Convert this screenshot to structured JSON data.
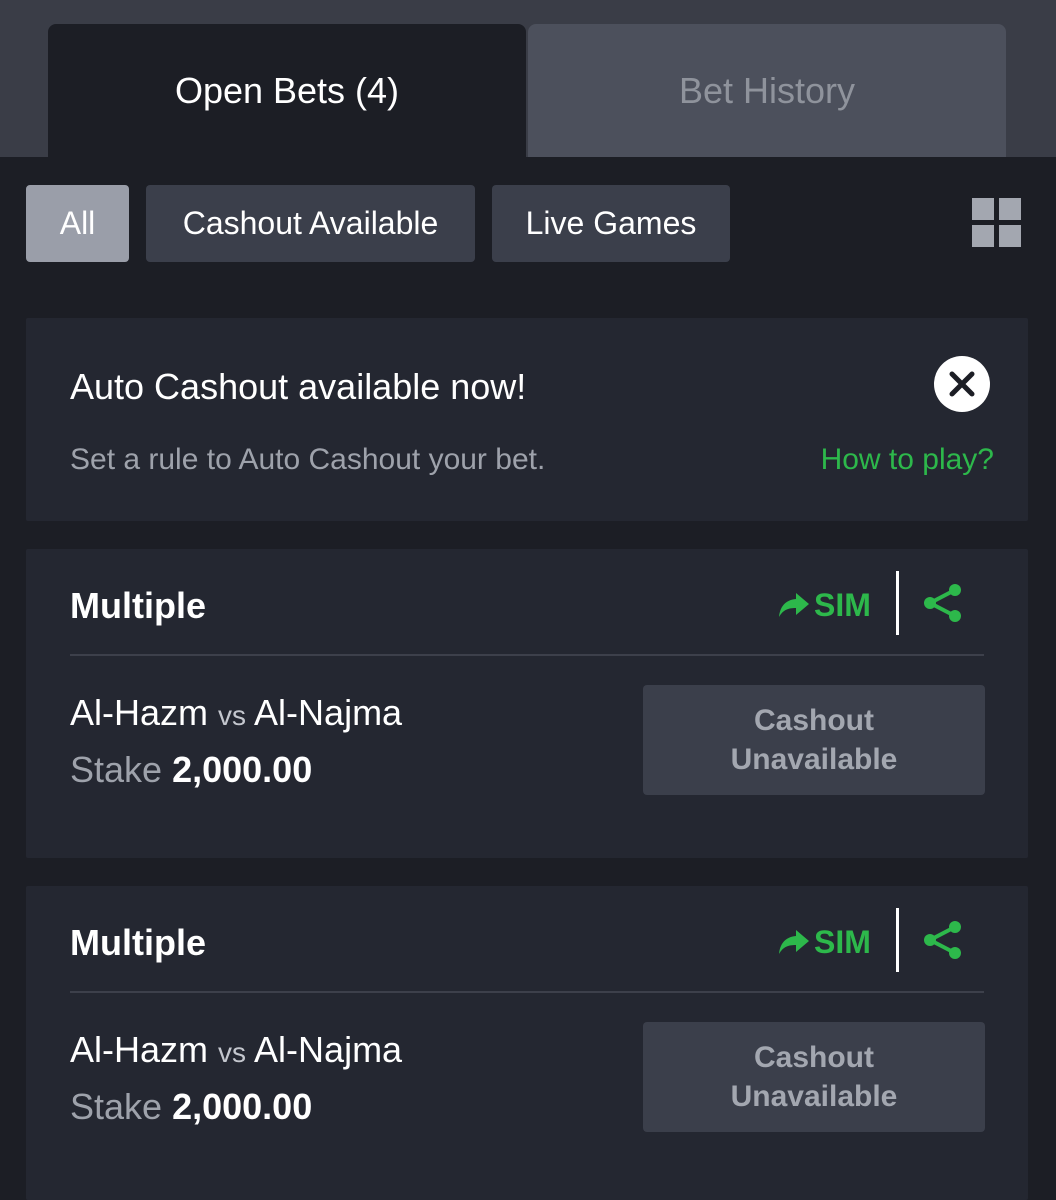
{
  "tabs": {
    "open_bets": "Open Bets (4)",
    "bet_history": "Bet History"
  },
  "filters": {
    "all": "All",
    "cashout_available": "Cashout Available",
    "live_games": "Live Games",
    "layout_toggle_icon": "grid-icon"
  },
  "promo": {
    "title": "Auto Cashout available now!",
    "subtitle": "Set a rule to Auto Cashout your bet.",
    "link": "How to play?",
    "close_icon": "close-icon"
  },
  "bets": [
    {
      "type": "Multiple",
      "sim": "SIM",
      "home": "Al-Hazm",
      "vs": "vs",
      "away": "Al-Najma",
      "stake_label": "Stake",
      "stake_amount": "2,000.00",
      "cashout_line1": "Cashout",
      "cashout_line2": "Unavailable"
    },
    {
      "type": "Multiple",
      "sim": "SIM",
      "home": "Al-Hazm",
      "vs": "vs",
      "away": "Al-Najma",
      "stake_label": "Stake",
      "stake_amount": "2,000.00",
      "cashout_line1": "Cashout",
      "cashout_line2": "Unavailable"
    }
  ],
  "colors": {
    "background": "#1c1e25",
    "card": "#242731",
    "accent_green": "#2db84b",
    "chip": "#3b3f4b",
    "chip_active": "#9a9ea9"
  }
}
